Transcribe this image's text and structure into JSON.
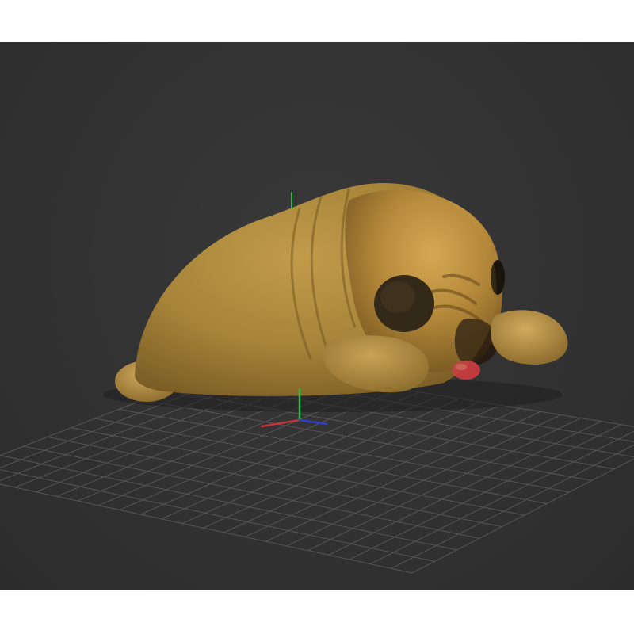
{
  "viewport": {
    "background_color": "#333333",
    "grid_color": "#5c5c5c",
    "model_color": "#a8853a",
    "gizmo_axes": {
      "x_color": "#c2333a",
      "y_color": "#2fb94a",
      "z_color": "#2f3fc9"
    },
    "model_subject": "sleeping pug"
  }
}
